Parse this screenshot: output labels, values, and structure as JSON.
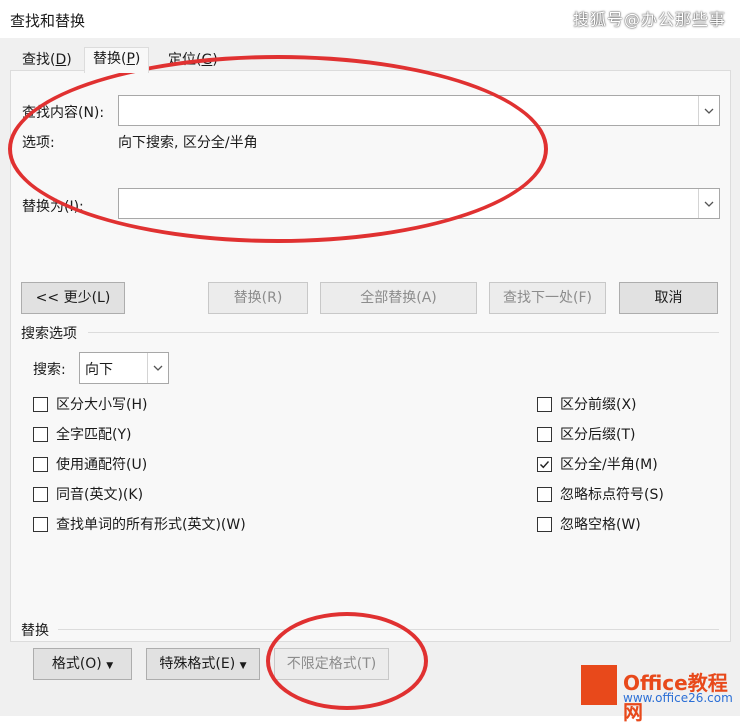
{
  "window": {
    "title": "查找和替换"
  },
  "watermark": {
    "top": "搜狐号@办公那些事"
  },
  "tabs": [
    {
      "label": "查找(",
      "key": "D",
      "suffix": ")"
    },
    {
      "label": "替换(",
      "key": "P",
      "suffix": ")"
    },
    {
      "label": "定位(",
      "key": "G",
      "suffix": ")"
    }
  ],
  "find": {
    "label": "查找内容(N):",
    "value": "",
    "options_label": "选项:",
    "options_value": "向下搜索, 区分全/半角"
  },
  "replace": {
    "label": "替换为(I):",
    "value": ""
  },
  "buttons": {
    "less": "<< 更少(L)",
    "replace": "替换(R)",
    "replace_all": "全部替换(A)",
    "find_next": "查找下一处(F)",
    "cancel": "取消"
  },
  "search_options": {
    "section": "搜索选项",
    "search_label": "搜索:",
    "search_value": "向下",
    "left": [
      {
        "label": "区分大小写(H)",
        "checked": false
      },
      {
        "label": "全字匹配(Y)",
        "checked": false
      },
      {
        "label": "使用通配符(U)",
        "checked": false
      },
      {
        "label": "同音(英文)(K)",
        "checked": false
      },
      {
        "label": "查找单词的所有形式(英文)(W)",
        "checked": false
      }
    ],
    "right": [
      {
        "label": "区分前缀(X)",
        "checked": false
      },
      {
        "label": "区分后缀(T)",
        "checked": false
      },
      {
        "label": "区分全/半角(M)",
        "checked": true
      },
      {
        "label": "忽略标点符号(S)",
        "checked": false
      },
      {
        "label": "忽略空格(W)",
        "checked": false
      }
    ]
  },
  "replace_section": {
    "title": "替换",
    "format": "格式(O)",
    "special": "特殊格式(E)",
    "no_format": "不限定格式(T)"
  },
  "logo": {
    "name": "Office教程网",
    "url": "www.office26.com"
  },
  "colors": {
    "annotation": "#e03131",
    "logo": "#e8491b",
    "logo_url": "#2b6fd6"
  }
}
